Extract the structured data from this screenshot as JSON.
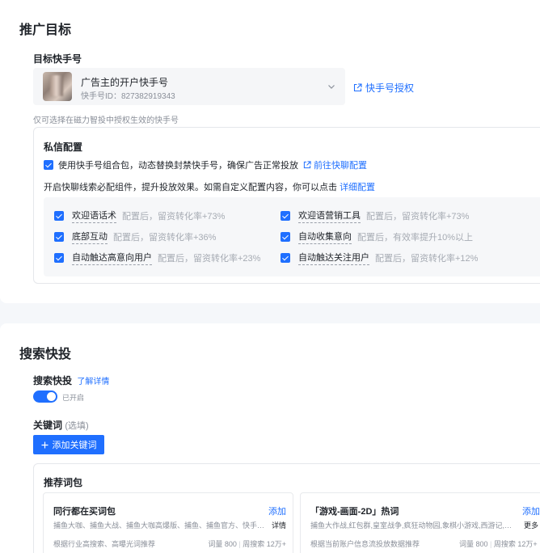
{
  "promo_target": {
    "title": "推广目标",
    "account_label": "目标快手号",
    "account": {
      "name": "广告主的开户快手号",
      "id": "快手号ID：827382919343"
    },
    "auth_link": "快手号授权",
    "hint": "仅可选择在磁力智投中授权生效的快手号"
  },
  "private_msg": {
    "title": "私信配置",
    "combo_check": "使用快手号组合包，动态替换封禁快手号，确保广告正常投放",
    "combo_link": "前往快聊配置",
    "desc": "开启快聊线索必配组件，提升投放效果。如需自定义配置内容，你可以点击",
    "detail_link": "详细配置",
    "options": [
      {
        "name": "欢迎语话术",
        "note": "配置后，留资转化率+73%",
        "checked": true
      },
      {
        "name": "欢迎语营销工具",
        "note": "配置后，留资转化率+73%",
        "checked": true
      },
      {
        "name": "底部互动",
        "note": "配置后，留资转化率+36%",
        "checked": true
      },
      {
        "name": "自动收集意向",
        "note": "配置后，有效率提升10%以上",
        "checked": true
      },
      {
        "name": "自动触达高意向用户",
        "note": "配置后，留资转化率+23%",
        "checked": true
      },
      {
        "name": "自动触达关注用户",
        "note": "配置后，留资转化率+12%",
        "checked": true
      }
    ]
  },
  "search": {
    "title": "搜索快投",
    "label": "搜索快投",
    "learn_more": "了解详情",
    "toggle_on": true,
    "toggle_text": "已开启",
    "keyword_label": "关键词",
    "keyword_optional": "(选填)",
    "add_keyword": "添加关键词",
    "rec_title": "推荐词包",
    "packs": [
      {
        "title": "同行都在买词包",
        "add": "添加",
        "words": "捕鱼大咖、捕鱼大战、捕鱼大咖高爆版、捕鱼、捕鱼官方、快手…",
        "more": "详情",
        "source": "根据行业高搜索、高曝光词推荐",
        "count": "词量 800",
        "weekly": "周搜索 12万+"
      },
      {
        "title": "「游戏-画面-2D」热词",
        "add": "添加",
        "words": "捕鱼大作战,红包群,皇室战争,疯狂动物园,象棋小游戏,西游记,…",
        "more": "更多",
        "source": "根据当前账户信息流投放数据推荐",
        "count": "词量 800",
        "weekly": "周搜索 12万+"
      }
    ]
  },
  "colors": {
    "accent": "#1f6fff",
    "page_bg": "#f5f7fa",
    "muted_text": "#8a8f99"
  }
}
